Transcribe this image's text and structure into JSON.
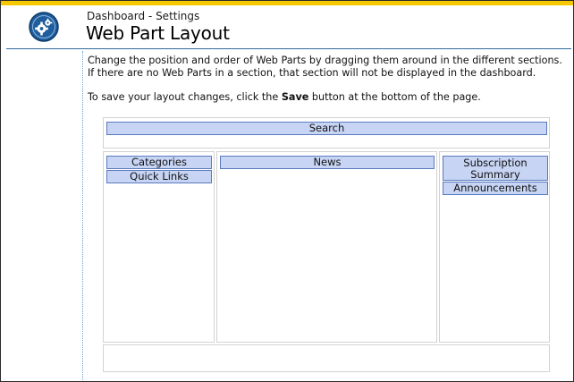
{
  "header": {
    "breadcrumb": "Dashboard - Settings",
    "title": "Web Part Layout",
    "icon": "gear-icon"
  },
  "instructions": {
    "line1": "Change the position and order of Web Parts by dragging them around in the different sections.",
    "line2": "If there are no Web Parts in a section, that section will not be displayed in the dashboard.",
    "save_before": "To save your layout changes, click the ",
    "save_bold": "Save",
    "save_after": " button at the bottom of the page."
  },
  "layout": {
    "top_zone": [
      "Search"
    ],
    "left_zone": [
      "Categories",
      "Quick Links"
    ],
    "center_zone": [
      "News"
    ],
    "right_zone": [
      "Subscription Summary",
      "Announcements"
    ],
    "bottom_zone": []
  },
  "colors": {
    "accent_stripe": "#f5c800",
    "web_part_fill": "#c7d4f4",
    "web_part_border": "#5a7bbf",
    "header_rule": "#2f6c9e"
  }
}
